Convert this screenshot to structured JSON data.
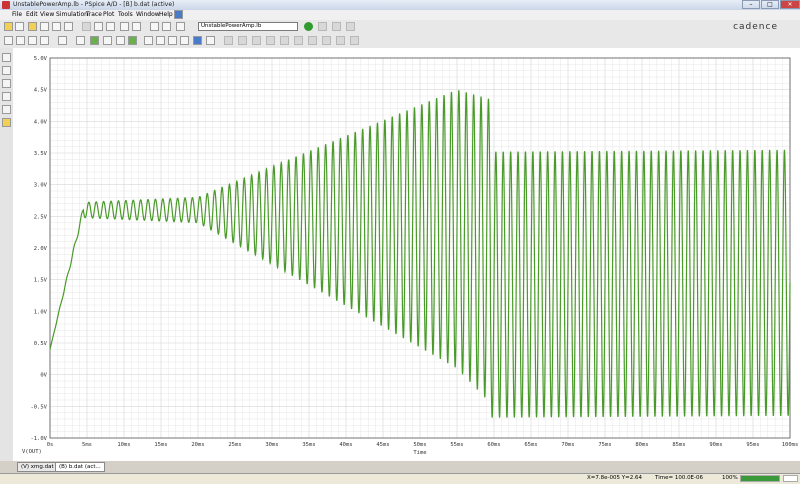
{
  "window": {
    "title": "UnstablePowerAmp.lb - PSpice A/D - [B] b.dat (active)",
    "min": "–",
    "max": "□",
    "close": "✕"
  },
  "menu": [
    "File",
    "Edit",
    "View",
    "Simulation",
    "Trace",
    "Plot",
    "Tools",
    "Window",
    "Help"
  ],
  "toolbar": {
    "profile_combo": "UnstablePowerAmp.lb",
    "brand": "cadence"
  },
  "colors": {
    "trace": "#4a9a2a",
    "grid": "#d6d6d6",
    "accent_go": "#2f9a2f"
  },
  "chart_data": {
    "type": "line",
    "xlim": [
      0,
      100
    ],
    "ylim": [
      -1.0,
      5.0
    ],
    "x_ticks": [
      "0s",
      "5ms",
      "10ms",
      "15ms",
      "20ms",
      "25ms",
      "30ms",
      "35ms",
      "40ms",
      "45ms",
      "50ms",
      "55ms",
      "60ms",
      "65ms",
      "70ms",
      "75ms",
      "80ms",
      "85ms",
      "90ms",
      "95ms",
      "100ms"
    ],
    "y_ticks": [
      "5.0V",
      "4.5V",
      "4.0V",
      "3.5V",
      "3.0V",
      "2.5V",
      "2.0V",
      "1.5V",
      "1.0V",
      "0.5V",
      "0V",
      "-0.5V",
      "-1.0V"
    ],
    "legend": "V(OUT)",
    "xlabel": "Time",
    "grid": true,
    "series": [
      {
        "segments": [
          {
            "t": [
              0,
              4.5
            ],
            "center": [
              0.4,
              2.6
            ],
            "amp": [
              0.0,
              0.05
            ]
          },
          {
            "t": [
              4.5,
              20
            ],
            "center": [
              2.6,
              2.6
            ],
            "amp": [
              0.12,
              0.2
            ]
          },
          {
            "t": [
              20,
              55
            ],
            "center": [
              2.6,
              2.3
            ],
            "amp": [
              0.2,
              2.2
            ]
          },
          {
            "t": [
              55,
              59.5
            ],
            "center": [
              2.3,
              1.95
            ],
            "amp": [
              2.2,
              2.4
            ]
          },
          {
            "t": [
              59.5,
              100
            ],
            "center": [
              1.42,
              1.45
            ],
            "amp": [
              2.1,
              2.1
            ]
          }
        ],
        "period_ms": 1.0
      }
    ]
  },
  "tabs": [
    "(V) xmg.dat",
    "(B) b.dat (act..."
  ],
  "status": {
    "cursor": "X=7.8e-005  Y=2.64",
    "time": "Time= 100.0E-06",
    "progress": "100%"
  }
}
